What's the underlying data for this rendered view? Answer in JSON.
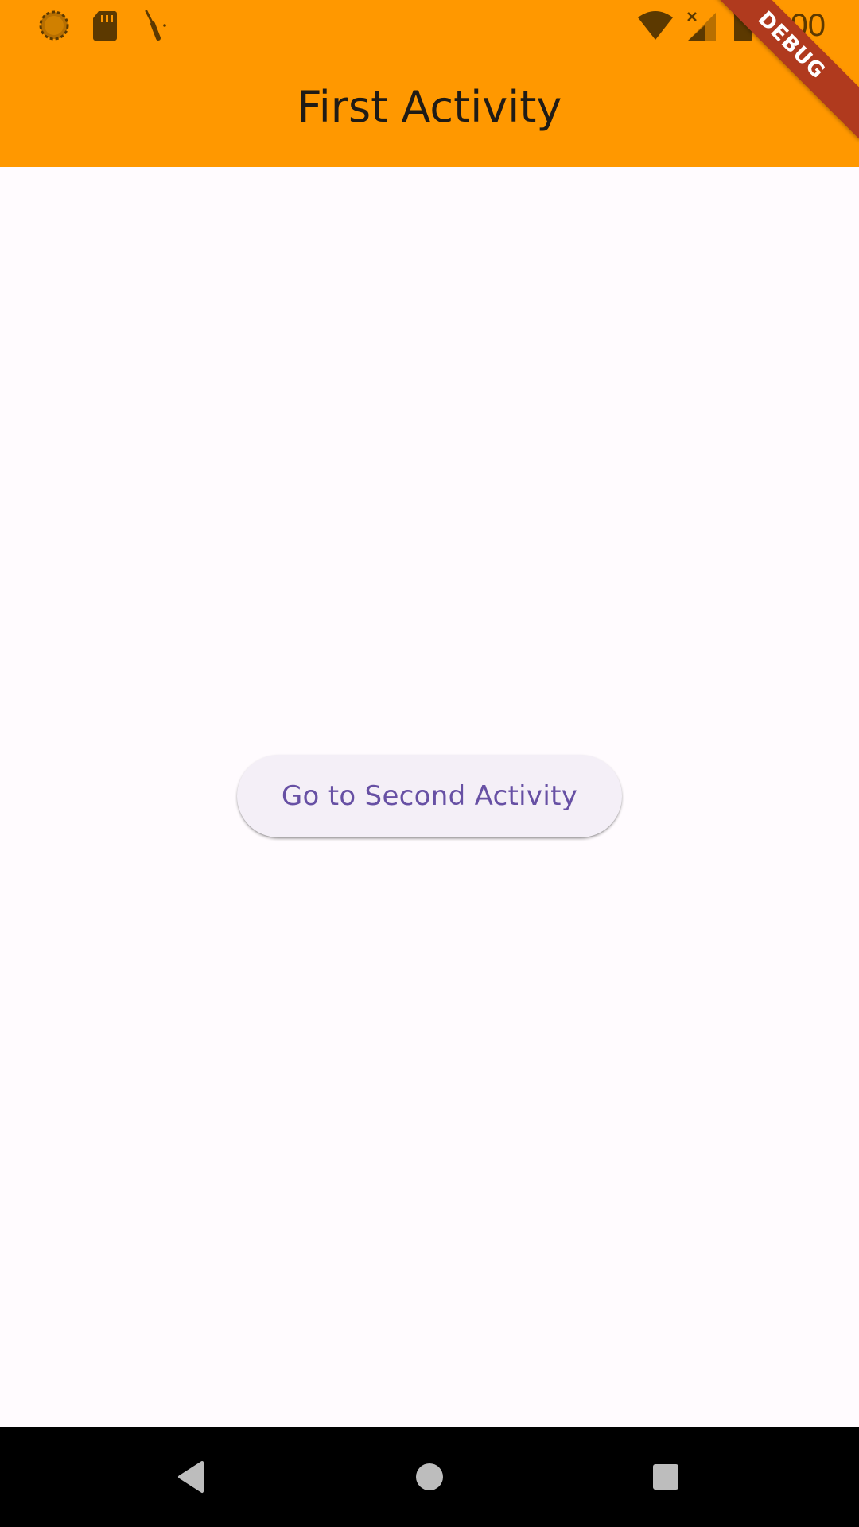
{
  "status_bar": {
    "time": "1:00",
    "left_icons": [
      "sync-icon",
      "sd-card-icon",
      "screwdriver-icon"
    ],
    "right_icons": [
      "wifi-icon",
      "cell-signal-icon",
      "battery-icon"
    ]
  },
  "debug_banner": {
    "label": "DEBUG"
  },
  "app_bar": {
    "title": "First Activity",
    "background": "#FF9800"
  },
  "main": {
    "button_label": "Go to Second Activity",
    "button_text_color": "#6750A4",
    "background": "#FFFBFE"
  },
  "nav_bar": {
    "items": [
      {
        "name": "back-icon"
      },
      {
        "name": "home-icon"
      },
      {
        "name": "recents-icon"
      }
    ]
  }
}
